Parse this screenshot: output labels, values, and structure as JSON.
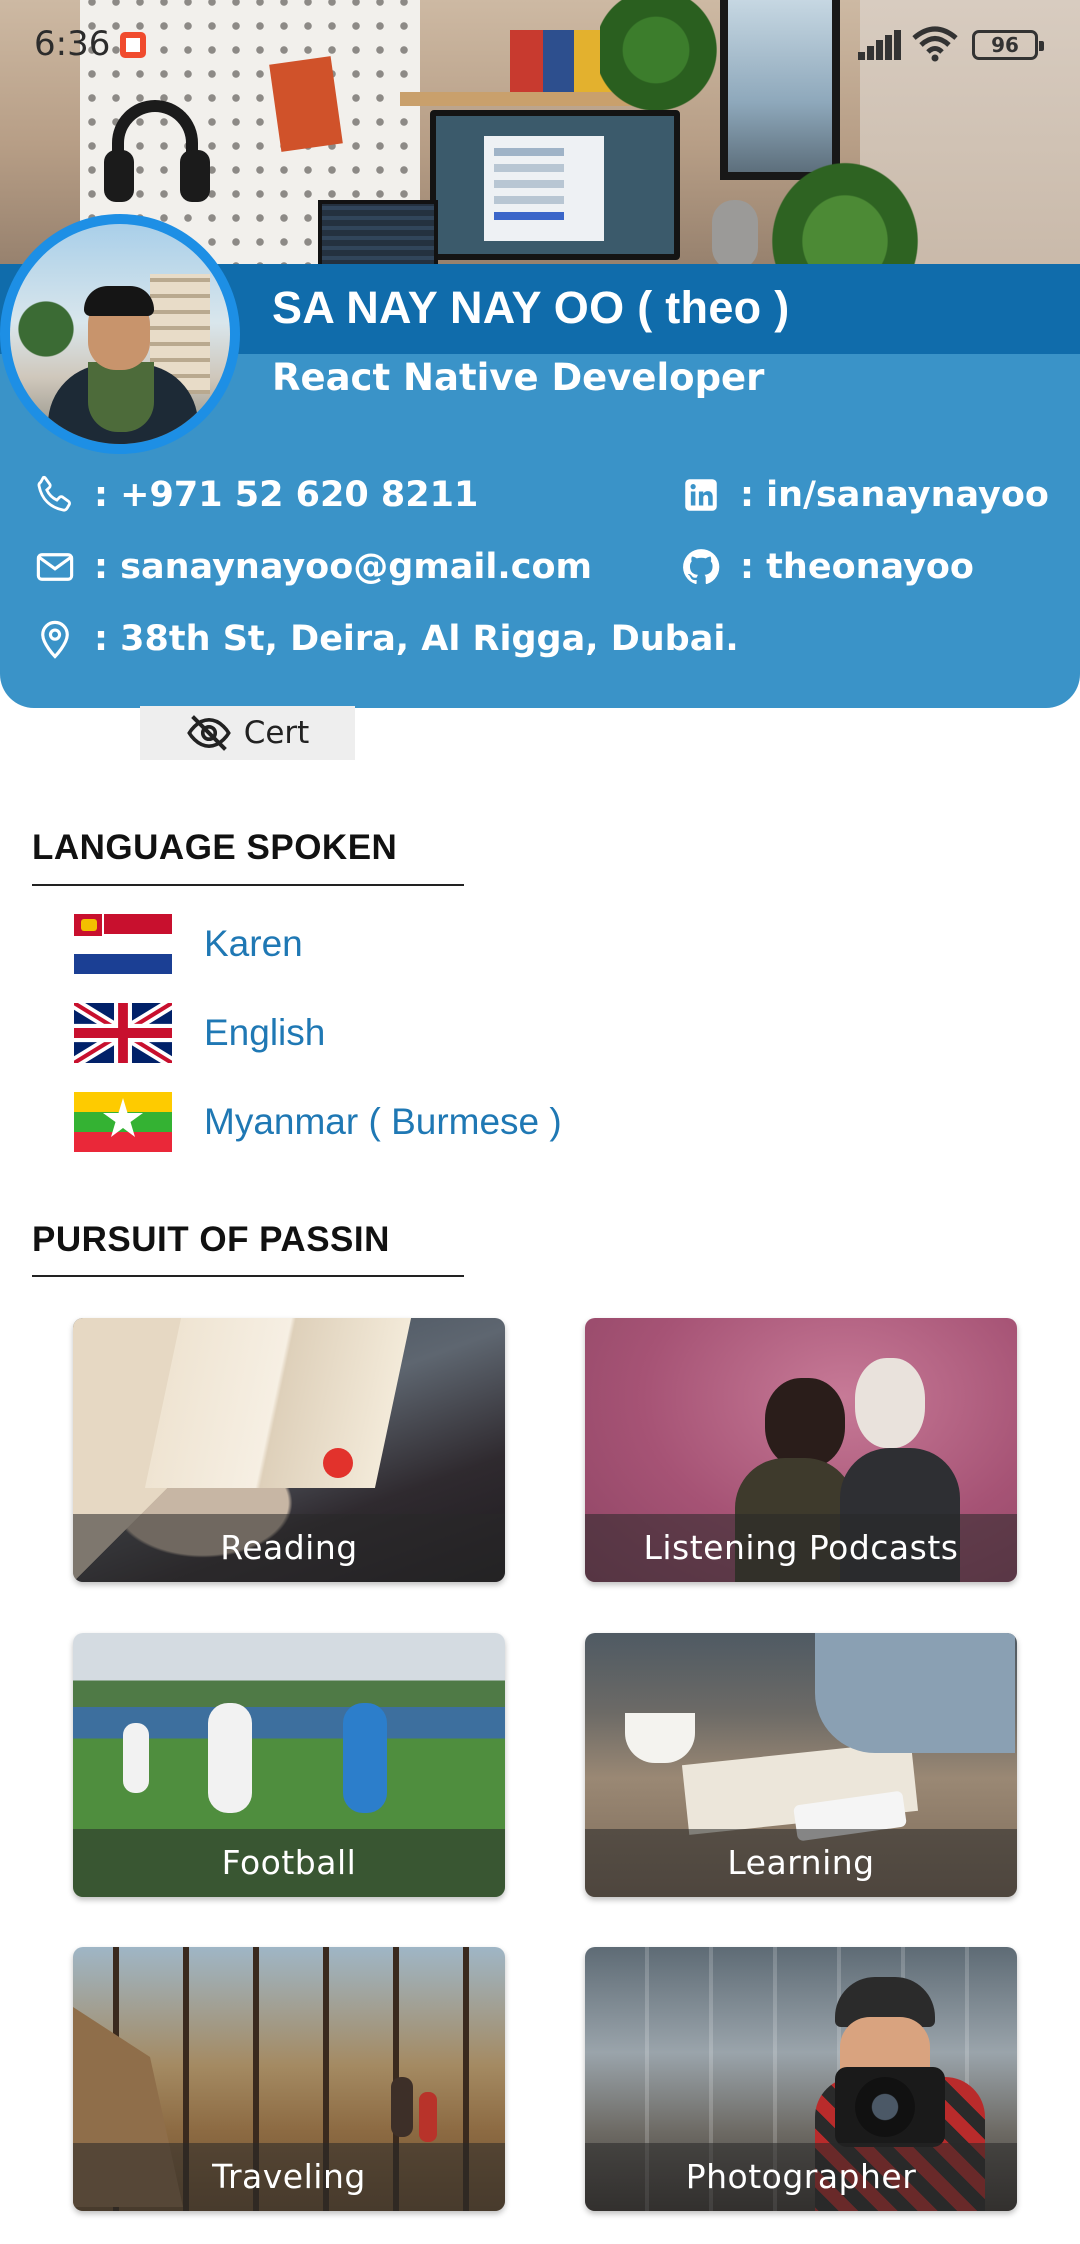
{
  "status_bar": {
    "time": "6:36",
    "battery": "96"
  },
  "profile": {
    "name": "SA NAY NAY OO ( theo )",
    "title": "React Native Developer",
    "phone": ": +971 52 620 8211",
    "email": ": sanaynayoo@gmail.com",
    "address": ": 38th St, Deira, Al Rigga, Dubai.",
    "linkedin": ": in/sanaynayoo",
    "github": ": theonayoo"
  },
  "cert_button": {
    "label": "Cert"
  },
  "languages": {
    "heading": "LANGUAGE SPOKEN",
    "items": [
      {
        "label": "Karen",
        "flag": "karen-flag"
      },
      {
        "label": "English",
        "flag": "uk-flag"
      },
      {
        "label": "Myanmar ( Burmese )",
        "flag": "myanmar-flag"
      }
    ]
  },
  "passions": {
    "heading": "PURSUIT OF PASSIN",
    "items": [
      {
        "label": "Reading"
      },
      {
        "label": "Listening Podcasts"
      },
      {
        "label": "Football"
      },
      {
        "label": "Learning"
      },
      {
        "label": "Traveling"
      },
      {
        "label": "Photographer"
      }
    ]
  },
  "colors": {
    "card_blue": "#3a93c8",
    "band_blue": "#0d68a8",
    "avatar_ring": "#1d8fe5",
    "link_blue": "#1f78b4"
  }
}
